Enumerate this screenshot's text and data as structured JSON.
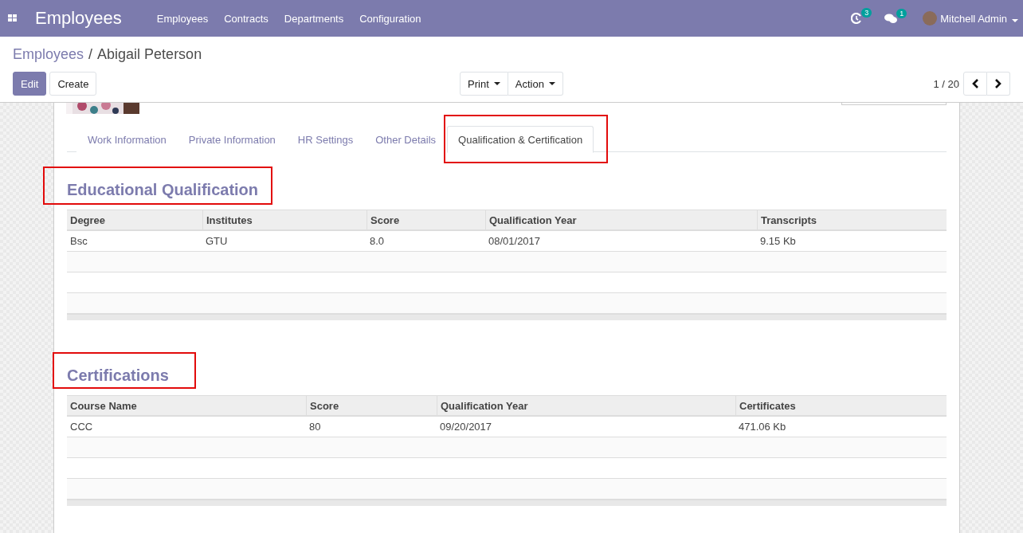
{
  "navbar": {
    "app_title": "Employees",
    "menu": [
      "Employees",
      "Contracts",
      "Departments",
      "Configuration"
    ],
    "activity_count": "3",
    "message_count": "1",
    "user": "Mitchell Admin"
  },
  "breadcrumb": {
    "parent": "Employees",
    "separator": "/",
    "current": "Abigail Peterson"
  },
  "buttons": {
    "edit": "Edit",
    "create": "Create",
    "print": "Print",
    "action": "Action"
  },
  "pager": "1 / 20",
  "tabs": [
    {
      "label": "Work Information",
      "selected": false,
      "highlighted": false
    },
    {
      "label": "Private Information",
      "selected": false,
      "highlighted": false
    },
    {
      "label": "HR Settings",
      "selected": false,
      "highlighted": false
    },
    {
      "label": "Other Details",
      "selected": false,
      "highlighted": false
    },
    {
      "label": "Qualification & Certification",
      "selected": true,
      "highlighted": true
    }
  ],
  "sections": [
    {
      "title": "Educational Qualification",
      "highlighted": true,
      "columns": [
        "Degree",
        "Institutes",
        "Score",
        "Qualification Year",
        "Transcripts"
      ],
      "rows": [
        [
          "Bsc",
          "GTU",
          "8.0",
          "08/01/2017",
          "9.15 Kb"
        ]
      ]
    },
    {
      "title": "Certifications",
      "highlighted": true,
      "columns": [
        "Course Name",
        "Score",
        "Qualification Year",
        "Certificates"
      ],
      "rows": [
        [
          "CCC",
          "80",
          "09/20/2017",
          "471.06 Kb"
        ]
      ]
    }
  ]
}
